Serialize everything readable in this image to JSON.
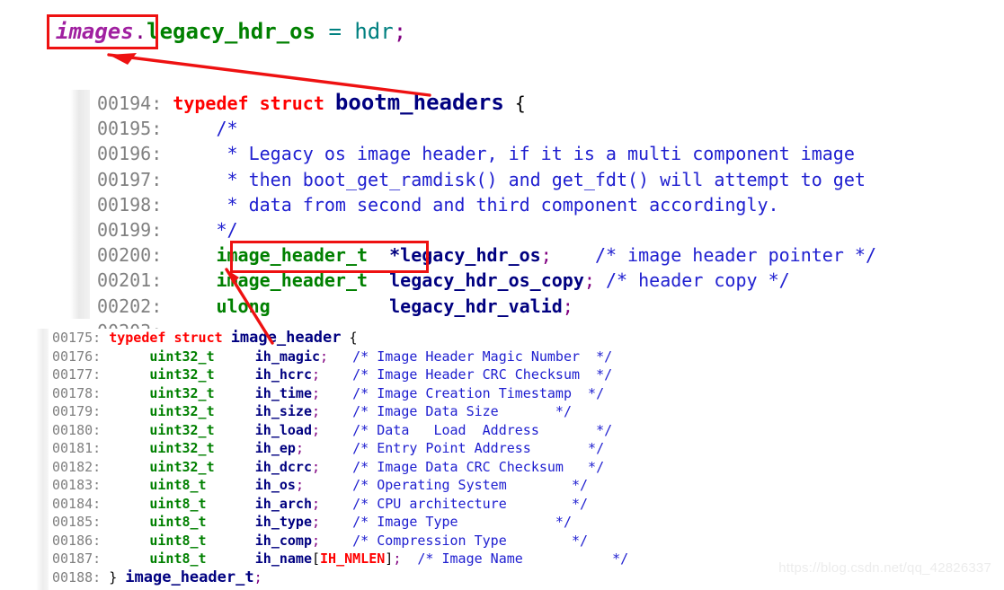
{
  "top_snippet": {
    "object": "images",
    "dot": ".",
    "member": "legacy_hdr_os",
    "assign": " = ",
    "value": "hdr",
    "semicolon": ";"
  },
  "main_block": {
    "lines": [
      {
        "number": "00194:",
        "parts": [
          {
            "text": " ",
            "cls": "plain"
          },
          {
            "text": "typedef struct",
            "cls": "kw"
          },
          {
            "text": " ",
            "cls": "plain"
          },
          {
            "text": "bootm_headers",
            "cls": "ident big"
          },
          {
            "text": " {",
            "cls": "plain"
          }
        ]
      },
      {
        "number": "00195:",
        "parts": [
          {
            "text": "     /*",
            "cls": "cmt"
          }
        ]
      },
      {
        "number": "00196:",
        "parts": [
          {
            "text": "      * Legacy os image header, if it is a multi component image",
            "cls": "cmt"
          }
        ]
      },
      {
        "number": "00197:",
        "parts": [
          {
            "text": "      * then boot_get_ramdisk() and get_fdt() will attempt to get",
            "cls": "cmt"
          }
        ]
      },
      {
        "number": "00198:",
        "parts": [
          {
            "text": "      * data from second and third component accordingly.",
            "cls": "cmt"
          }
        ]
      },
      {
        "number": "00199:",
        "parts": [
          {
            "text": "     */",
            "cls": "cmt"
          }
        ]
      },
      {
        "number": "00200:",
        "parts": [
          {
            "text": "     ",
            "cls": "plain"
          },
          {
            "text": "image_header_t",
            "cls": "type"
          },
          {
            "text": "  ",
            "cls": "plain"
          },
          {
            "text": "*legacy_hdr_os",
            "cls": "ident"
          },
          {
            "text": ";",
            "cls": "punc"
          },
          {
            "text": "    ",
            "cls": "plain"
          },
          {
            "text": "/* image header pointer */",
            "cls": "cmt"
          }
        ]
      },
      {
        "number": "00201:",
        "parts": [
          {
            "text": "     ",
            "cls": "plain"
          },
          {
            "text": "image_header_t",
            "cls": "type"
          },
          {
            "text": "  ",
            "cls": "plain"
          },
          {
            "text": "legacy_hdr_os_copy",
            "cls": "ident"
          },
          {
            "text": ";",
            "cls": "punc"
          },
          {
            "text": " ",
            "cls": "plain"
          },
          {
            "text": "/* header copy */",
            "cls": "cmt"
          }
        ]
      },
      {
        "number": "00202:",
        "parts": [
          {
            "text": "     ",
            "cls": "plain"
          },
          {
            "text": "ulong",
            "cls": "type"
          },
          {
            "text": "           ",
            "cls": "plain"
          },
          {
            "text": "legacy_hdr_valid",
            "cls": "ident"
          },
          {
            "text": ";",
            "cls": "punc"
          }
        ]
      },
      {
        "number": "00203:",
        "parts": [
          {
            "text": "",
            "cls": "plain"
          }
        ]
      }
    ]
  },
  "lower_block": {
    "lines": [
      {
        "number": "00175:",
        "parts": [
          {
            "text": " ",
            "cls": "plain"
          },
          {
            "text": "typedef struct",
            "cls": "kw"
          },
          {
            "text": " ",
            "cls": "plain"
          },
          {
            "text": "image_header",
            "cls": "ident big"
          },
          {
            "text": " {",
            "cls": "plain"
          }
        ]
      },
      {
        "number": "00176:",
        "parts": [
          {
            "text": "      ",
            "cls": "plain"
          },
          {
            "text": "uint32_t",
            "cls": "type"
          },
          {
            "text": "     ",
            "cls": "plain"
          },
          {
            "text": "ih_magic",
            "cls": "ident"
          },
          {
            "text": ";",
            "cls": "punc"
          },
          {
            "text": "   ",
            "cls": "plain"
          },
          {
            "text": "/* Image Header Magic Number  */",
            "cls": "cmt"
          }
        ]
      },
      {
        "number": "00177:",
        "parts": [
          {
            "text": "      ",
            "cls": "plain"
          },
          {
            "text": "uint32_t",
            "cls": "type"
          },
          {
            "text": "     ",
            "cls": "plain"
          },
          {
            "text": "ih_hcrc",
            "cls": "ident"
          },
          {
            "text": ";",
            "cls": "punc"
          },
          {
            "text": "    ",
            "cls": "plain"
          },
          {
            "text": "/* Image Header CRC Checksum  */",
            "cls": "cmt"
          }
        ]
      },
      {
        "number": "00178:",
        "parts": [
          {
            "text": "      ",
            "cls": "plain"
          },
          {
            "text": "uint32_t",
            "cls": "type"
          },
          {
            "text": "     ",
            "cls": "plain"
          },
          {
            "text": "ih_time",
            "cls": "ident"
          },
          {
            "text": ";",
            "cls": "punc"
          },
          {
            "text": "    ",
            "cls": "plain"
          },
          {
            "text": "/* Image Creation Timestamp  */",
            "cls": "cmt"
          }
        ]
      },
      {
        "number": "00179:",
        "parts": [
          {
            "text": "      ",
            "cls": "plain"
          },
          {
            "text": "uint32_t",
            "cls": "type"
          },
          {
            "text": "     ",
            "cls": "plain"
          },
          {
            "text": "ih_size",
            "cls": "ident"
          },
          {
            "text": ";",
            "cls": "punc"
          },
          {
            "text": "    ",
            "cls": "plain"
          },
          {
            "text": "/* Image Data Size       */",
            "cls": "cmt"
          }
        ]
      },
      {
        "number": "00180:",
        "parts": [
          {
            "text": "      ",
            "cls": "plain"
          },
          {
            "text": "uint32_t",
            "cls": "type"
          },
          {
            "text": "     ",
            "cls": "plain"
          },
          {
            "text": "ih_load",
            "cls": "ident"
          },
          {
            "text": ";",
            "cls": "punc"
          },
          {
            "text": "    ",
            "cls": "plain"
          },
          {
            "text": "/* Data   Load  Address       */",
            "cls": "cmt"
          }
        ]
      },
      {
        "number": "00181:",
        "parts": [
          {
            "text": "      ",
            "cls": "plain"
          },
          {
            "text": "uint32_t",
            "cls": "type"
          },
          {
            "text": "     ",
            "cls": "plain"
          },
          {
            "text": "ih_ep",
            "cls": "ident"
          },
          {
            "text": ";",
            "cls": "punc"
          },
          {
            "text": "      ",
            "cls": "plain"
          },
          {
            "text": "/* Entry Point Address       */",
            "cls": "cmt"
          }
        ]
      },
      {
        "number": "00182:",
        "parts": [
          {
            "text": "      ",
            "cls": "plain"
          },
          {
            "text": "uint32_t",
            "cls": "type"
          },
          {
            "text": "     ",
            "cls": "plain"
          },
          {
            "text": "ih_dcrc",
            "cls": "ident"
          },
          {
            "text": ";",
            "cls": "punc"
          },
          {
            "text": "    ",
            "cls": "plain"
          },
          {
            "text": "/* Image Data CRC Checksum   */",
            "cls": "cmt"
          }
        ]
      },
      {
        "number": "00183:",
        "parts": [
          {
            "text": "      ",
            "cls": "plain"
          },
          {
            "text": "uint8_t",
            "cls": "type"
          },
          {
            "text": "      ",
            "cls": "plain"
          },
          {
            "text": "ih_os",
            "cls": "ident"
          },
          {
            "text": ";",
            "cls": "punc"
          },
          {
            "text": "      ",
            "cls": "plain"
          },
          {
            "text": "/* Operating System        */",
            "cls": "cmt"
          }
        ]
      },
      {
        "number": "00184:",
        "parts": [
          {
            "text": "      ",
            "cls": "plain"
          },
          {
            "text": "uint8_t",
            "cls": "type"
          },
          {
            "text": "      ",
            "cls": "plain"
          },
          {
            "text": "ih_arch",
            "cls": "ident"
          },
          {
            "text": ";",
            "cls": "punc"
          },
          {
            "text": "    ",
            "cls": "plain"
          },
          {
            "text": "/* CPU architecture        */",
            "cls": "cmt"
          }
        ]
      },
      {
        "number": "00185:",
        "parts": [
          {
            "text": "      ",
            "cls": "plain"
          },
          {
            "text": "uint8_t",
            "cls": "type"
          },
          {
            "text": "      ",
            "cls": "plain"
          },
          {
            "text": "ih_type",
            "cls": "ident"
          },
          {
            "text": ";",
            "cls": "punc"
          },
          {
            "text": "    ",
            "cls": "plain"
          },
          {
            "text": "/* Image Type            */",
            "cls": "cmt"
          }
        ]
      },
      {
        "number": "00186:",
        "parts": [
          {
            "text": "      ",
            "cls": "plain"
          },
          {
            "text": "uint8_t",
            "cls": "type"
          },
          {
            "text": "      ",
            "cls": "plain"
          },
          {
            "text": "ih_comp",
            "cls": "ident"
          },
          {
            "text": ";",
            "cls": "punc"
          },
          {
            "text": "    ",
            "cls": "plain"
          },
          {
            "text": "/* Compression Type        */",
            "cls": "cmt"
          }
        ]
      },
      {
        "number": "00187:",
        "parts": [
          {
            "text": "      ",
            "cls": "plain"
          },
          {
            "text": "uint8_t",
            "cls": "type"
          },
          {
            "text": "      ",
            "cls": "plain"
          },
          {
            "text": "ih_name",
            "cls": "ident"
          },
          {
            "text": "[",
            "cls": "plain"
          },
          {
            "text": "IH_NMLEN",
            "cls": "macro"
          },
          {
            "text": "]",
            "cls": "plain"
          },
          {
            "text": ";",
            "cls": "punc"
          },
          {
            "text": "  ",
            "cls": "plain"
          },
          {
            "text": "/* Image Name           */",
            "cls": "cmt"
          }
        ]
      },
      {
        "number": "00188:",
        "parts": [
          {
            "text": " } ",
            "cls": "plain"
          },
          {
            "text": "image_header_t",
            "cls": "ident big"
          },
          {
            "text": ";",
            "cls": "punc"
          }
        ]
      }
    ]
  },
  "annotations": {
    "box_images_label": "images",
    "box_image_header_t_label": "image_header_t",
    "arrow_1_from": "images box",
    "arrow_1_to": "bootm_headers",
    "arrow_2_from": "image_header_t box",
    "arrow_2_to": "image_header"
  },
  "watermark": {
    "text": "https://blog.csdn.net/qq_42826337"
  },
  "colors": {
    "annotation_red": "#ee1111",
    "keyword_red": "#ff0000",
    "type_green": "#008000",
    "identifier_navy": "#000080",
    "comment_blue": "#2020d0",
    "punctuation_purple": "#800080",
    "value_teal": "#008080",
    "object_magenta": "#a020a0",
    "line_number_gray": "#808080",
    "watermark_gray": "#ececec"
  }
}
